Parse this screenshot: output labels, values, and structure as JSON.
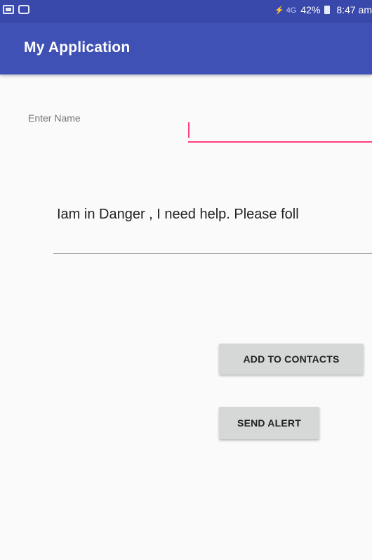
{
  "status_bar": {
    "signal_text": "⚡ 4G",
    "battery": "42%",
    "time": "8:47 am"
  },
  "app_bar": {
    "title": "My Application"
  },
  "form": {
    "name_label": "Enter Name",
    "name_value": "",
    "message_text": "Iam in Danger , I need help. Please foll"
  },
  "buttons": {
    "add_contacts": "ADD TO CONTACTS",
    "send_alert": "SEND ALERT"
  },
  "colors": {
    "primary": "#3f51b5",
    "primary_dark": "#3949ab",
    "accent": "#ff4081"
  }
}
